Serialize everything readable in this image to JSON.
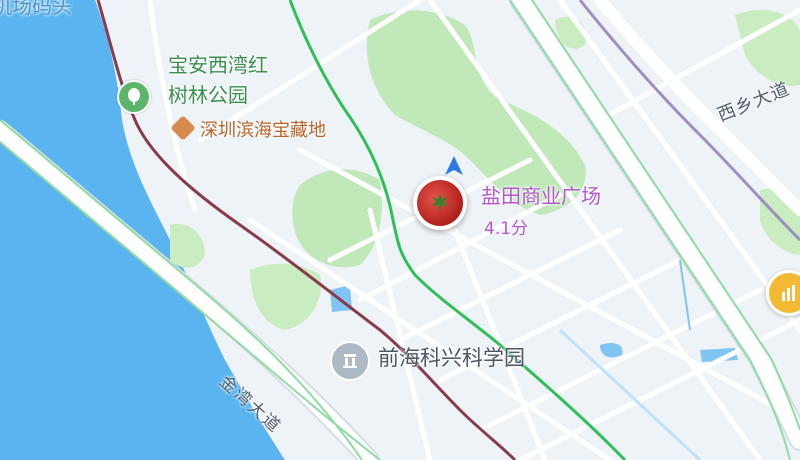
{
  "colors": {
    "water": "#59b4f0",
    "park": "#c1e8b9",
    "route": "#2ebf57",
    "metro_line": "#8a3b49",
    "metro_line_right": "#9d8fbf",
    "destination_label": "#b357cf",
    "poi_label": "#b8652a",
    "park_label": "#3c8f4d"
  },
  "labels": {
    "top_partial": "机场码头",
    "park_name_line1": "宝安西湾红",
    "park_name_line2": "树林公园",
    "poi": "深圳滨海宝藏地",
    "road_xixiang": "西乡大道",
    "road_jinwan": "金湾大道",
    "landmark": "前海科兴科学园"
  },
  "destination": {
    "name": "盐田商业广场",
    "eta": "4.1分",
    "marker_icon": "tomato-avatar-icon"
  },
  "icons": {
    "park": "tree-icon",
    "poi": "diamond-poi-icon",
    "landmark": "building-icon",
    "navigation": "navigation-arrow-icon",
    "badge": "sun-badge-icon"
  }
}
